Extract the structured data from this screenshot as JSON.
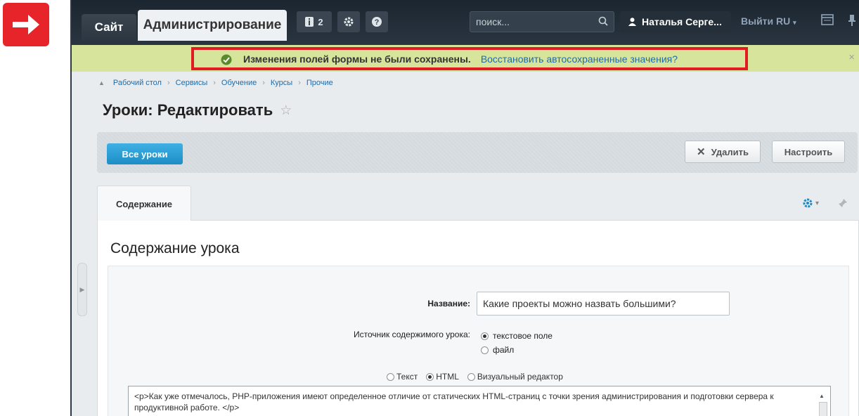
{
  "topbar": {
    "site_tab": "Сайт",
    "admin_tab": "Администрирование",
    "notifications_count": "2",
    "search_placeholder": "поиск...",
    "user_name": "Наталья Серге...",
    "logout": "Выйти",
    "language": "RU"
  },
  "notification": {
    "message": "Изменения полей формы не были сохранены.",
    "link": "Восстановить автосохраненные значения?",
    "close": "×"
  },
  "breadcrumb": [
    "Рабочий стол",
    "Сервисы",
    "Обучение",
    "Курсы",
    "Прочие"
  ],
  "page": {
    "title": "Уроки: Редактировать"
  },
  "toolbar": {
    "all_lessons": "Все уроки",
    "delete": "Удалить",
    "settings": "Настроить"
  },
  "tabs": {
    "content": "Содержание"
  },
  "form": {
    "section_title": "Содержание урока",
    "name_label": "Название:",
    "name_value": "Какие проекты можно назвать большими?",
    "source_label": "Источник содержимого урока:",
    "source_options": [
      "текстовое поле",
      "файл"
    ],
    "source_selected": "текстовое поле",
    "editor_modes": [
      "Текст",
      "HTML",
      "Визуальный редактор"
    ],
    "editor_mode_selected": "HTML",
    "body_text": "<p>Как уже отмечалось, PHP-приложения имеют определенное отличие от статических HTML-страниц с точки зрения администрирования и подготовки сервера к продуктивной работе. </p>"
  },
  "colors": {
    "topbar_bg": "#1c2630",
    "notify_bg": "#d6e59b",
    "highlight": "#e11b22",
    "accent_blue": "#1c8ec6",
    "link": "#1f6ba8"
  }
}
